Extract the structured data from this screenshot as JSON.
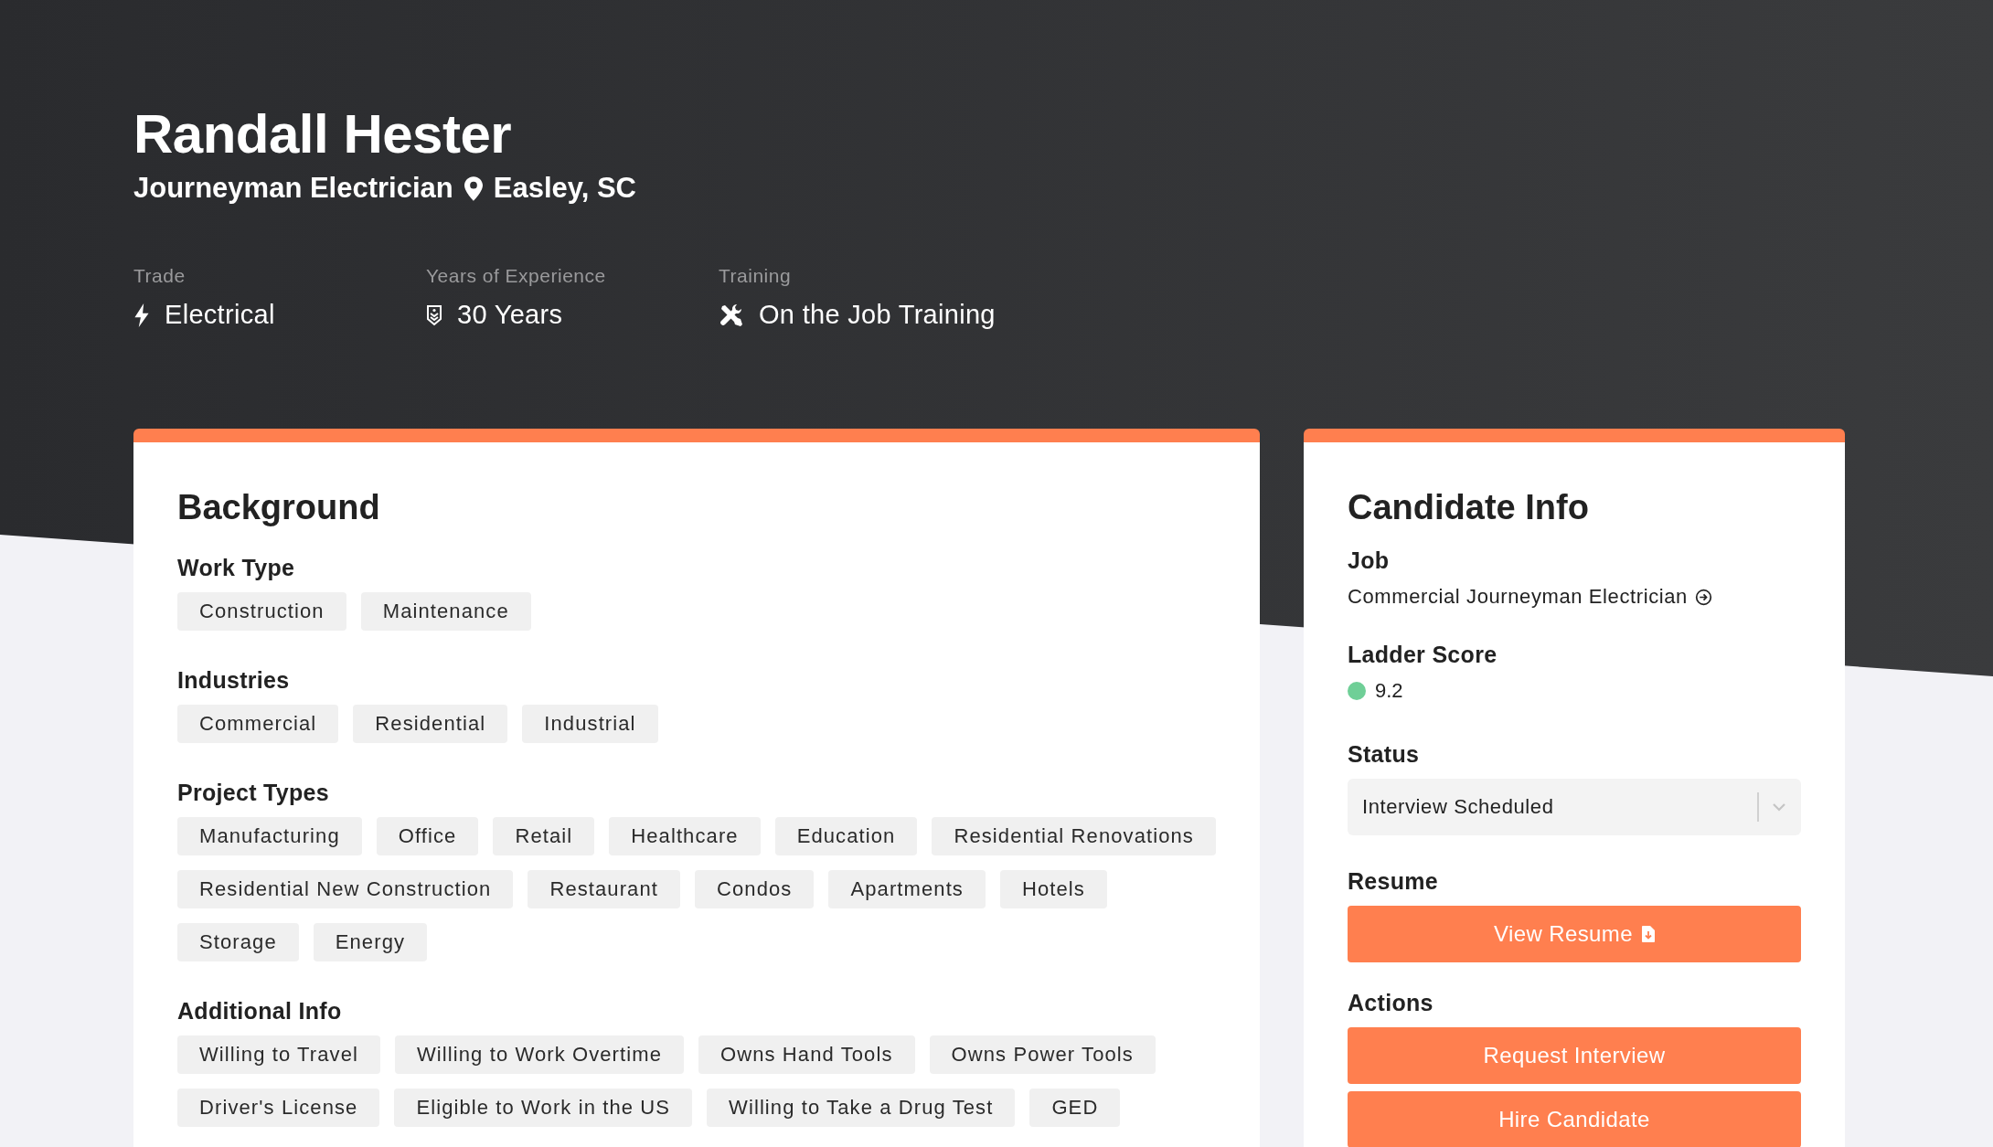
{
  "header": {
    "name": "Randall Hester",
    "title": "Journeyman Electrician",
    "location": "Easley, SC",
    "stats": [
      {
        "kind": "trade",
        "label": "Trade",
        "value": "Electrical"
      },
      {
        "kind": "experience",
        "label": "Years of Experience",
        "value": "30 Years"
      },
      {
        "kind": "training",
        "label": "Training",
        "value": "On the Job Training"
      }
    ]
  },
  "background": {
    "title": "Background",
    "sections": [
      {
        "title": "Work Type",
        "tags": [
          "Construction",
          "Maintenance"
        ]
      },
      {
        "title": "Industries",
        "tags": [
          "Commercial",
          "Residential",
          "Industrial"
        ]
      },
      {
        "title": "Project Types",
        "tags": [
          "Manufacturing",
          "Office",
          "Retail",
          "Healthcare",
          "Education",
          "Residential Renovations",
          "Residential New Construction",
          "Restaurant",
          "Condos",
          "Apartments",
          "Hotels",
          "Storage",
          "Energy"
        ]
      },
      {
        "title": "Additional Info",
        "tags": [
          "Willing to Travel",
          "Willing to Work Overtime",
          "Owns Hand Tools",
          "Owns Power Tools",
          "Driver's License",
          "Eligible to Work in the US",
          "Willing to Take a Drug Test",
          "GED"
        ]
      }
    ]
  },
  "candidate_info": {
    "title": "Candidate Info",
    "job": {
      "label": "Job",
      "value": "Commercial Journeyman Electrician"
    },
    "ladder_score": {
      "label": "Ladder Score",
      "value": "9.2",
      "color": "#6fcf97"
    },
    "status": {
      "label": "Status",
      "value": "Interview Scheduled"
    },
    "resume": {
      "label": "Resume",
      "button": "View Resume"
    },
    "actions": {
      "label": "Actions",
      "buttons": [
        "Request Interview",
        "Hire Candidate"
      ]
    }
  }
}
